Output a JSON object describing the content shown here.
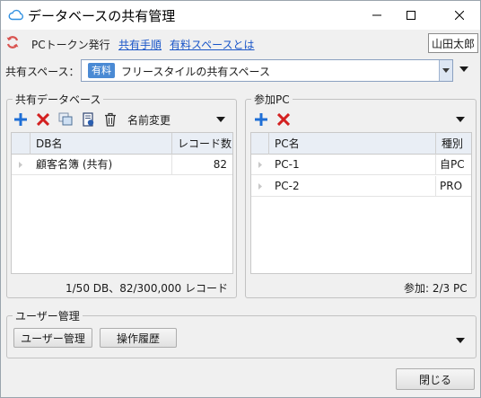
{
  "window": {
    "title": "データベースの共有管理"
  },
  "links": {
    "issue_token": "PCトークン発行",
    "share_steps": "共有手順",
    "what_is_paid_space": "有料スペースとは"
  },
  "user": {
    "name": "山田太郎"
  },
  "space": {
    "label": "共有スペース：",
    "badge": "有料",
    "selected": "フリースタイルの共有スペース"
  },
  "db_group": {
    "title": "共有データベース",
    "rename_label": "名前変更",
    "columns": [
      "DB名",
      "レコード数"
    ],
    "rows": [
      {
        "name": "顧客名簿 (共有)",
        "records": "82"
      }
    ],
    "footer": "1/50 DB、82/300,000 レコード"
  },
  "pc_group": {
    "title": "参加PC",
    "columns": [
      "PC名",
      "種別"
    ],
    "rows": [
      {
        "name": "PC-1",
        "type": "自PC"
      },
      {
        "name": "PC-2",
        "type": "PRO"
      }
    ],
    "footer": "参加: 2/3 PC"
  },
  "user_group": {
    "title": "ユーザー管理",
    "user_mgmt_button": "ユーザー管理",
    "history_button": "操作履歴"
  },
  "close_button": "閉じる",
  "colors": {
    "add": "#1f6fd6",
    "delete": "#d32020",
    "link": "#1a56c8",
    "badge": "#4a8ad4",
    "sync": "#d9534f"
  },
  "icons": [
    "cloud-icon",
    "sync-icon",
    "plus-icon",
    "delete-icon",
    "copy-icon",
    "export-icon",
    "trash-icon",
    "chevron-down-icon"
  ]
}
